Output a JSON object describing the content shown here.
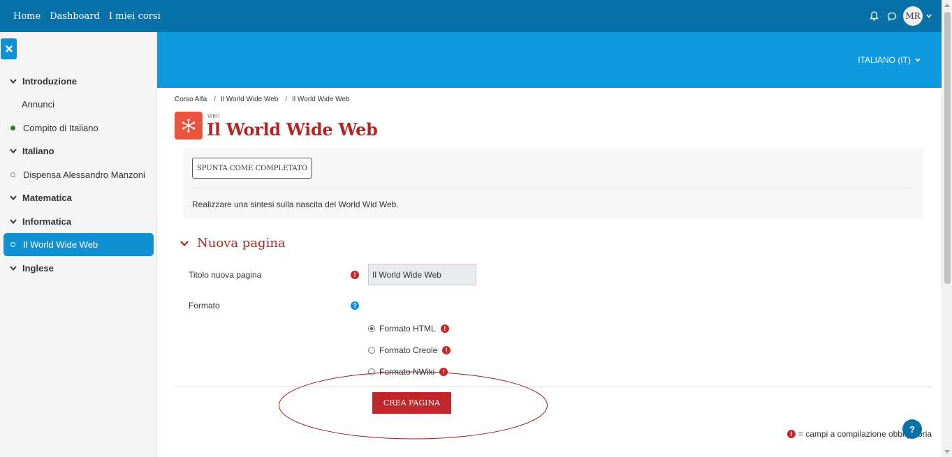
{
  "navbar": {
    "links": [
      "Home",
      "Dashboard",
      "I miei corsi"
    ],
    "user_initials": "MR",
    "bell_icon": "bell-icon",
    "chat_icon": "chat-icon"
  },
  "sidebar": {
    "close_icon": "close-icon",
    "items": [
      {
        "label": "Introduzione",
        "type": "section"
      },
      {
        "label": "Annunci",
        "type": "plain"
      },
      {
        "label": "Compito di Italiano",
        "type": "completed"
      },
      {
        "label": "Italiano",
        "type": "section"
      },
      {
        "label": "Dispensa Alessandro Manzoni",
        "type": "incomplete"
      },
      {
        "label": "Matematica",
        "type": "section"
      },
      {
        "label": "Informatica",
        "type": "section"
      },
      {
        "label": "Il World Wide Web",
        "type": "active"
      },
      {
        "label": "Inglese",
        "type": "section"
      }
    ]
  },
  "header": {
    "language": "ITALIANO (IT)"
  },
  "breadcrumb": [
    "Corso Alfa",
    "Il World Wide Web",
    "Il World Wide Web"
  ],
  "activity": {
    "module_label": "WIKI",
    "title": "Il World Wide Web",
    "icon": "wiki-icon"
  },
  "completion": {
    "button_label": "SPUNTA COME COMPLETATO",
    "description": "Realizzare una sintesi sulla nascita del World Wid Web."
  },
  "form": {
    "section_title": "Nuova pagina",
    "title_label": "Titolo nuova pagina",
    "title_value": "Il World Wide Web",
    "format_label": "Formato",
    "format_options": [
      {
        "label": "Formato HTML",
        "selected": true
      },
      {
        "label": "Formato Creole",
        "selected": false
      },
      {
        "label": "Formato NWiki",
        "selected": false
      }
    ],
    "submit_label": "CREA PAGINA",
    "required_note": "= campi a compilazione obbligatoria"
  },
  "colors": {
    "navbar": "#0672a7",
    "band": "#0f9adf",
    "accent_red": "#b32625",
    "active_item": "#0f91d2"
  },
  "help_fab_label": "?"
}
